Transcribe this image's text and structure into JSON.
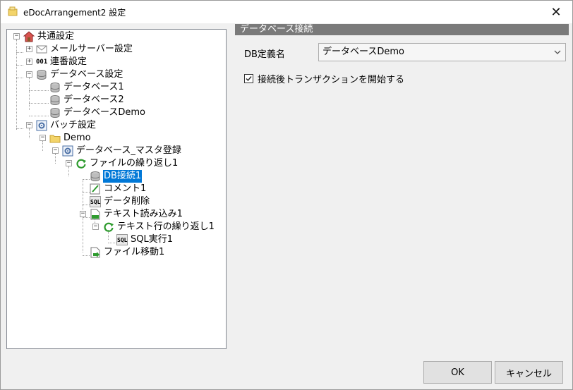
{
  "window": {
    "title": "eDocArrangement2 設定",
    "close_glyph": "✕"
  },
  "tree": {
    "items": [
      {
        "label": "共通設定"
      },
      {
        "label": "メールサーバー設定"
      },
      {
        "label": "連番設定"
      },
      {
        "label": "データベース設定"
      },
      {
        "label": "データベース1"
      },
      {
        "label": "データベース2"
      },
      {
        "label": "データベースDemo"
      },
      {
        "label": "バッチ設定"
      },
      {
        "label": "Demo"
      },
      {
        "label": "データベース_マスタ登録"
      },
      {
        "label": "ファイルの繰り返し1"
      },
      {
        "label": "DB接続1",
        "selected": true
      },
      {
        "label": "コメント1"
      },
      {
        "label": "データ削除"
      },
      {
        "label": "テキスト読み込み1"
      },
      {
        "label": "テキスト行の繰り返し1"
      },
      {
        "label": "SQL実行1"
      },
      {
        "label": "ファイル移動1"
      }
    ],
    "icon_texts": {
      "serial": "001",
      "sql": "SQL",
      "txt": "TXT"
    }
  },
  "detail": {
    "section_title": "データベース接続",
    "db_label": "DB定義名",
    "db_value": "データベースDemo",
    "checkbox_label": "接続後トランザクションを開始する",
    "checkbox_checked": true
  },
  "buttons": {
    "ok": "OK",
    "cancel": "キャンセル"
  },
  "colors": {
    "selection": "#0078d7",
    "header_bg": "#7a7a7a"
  }
}
